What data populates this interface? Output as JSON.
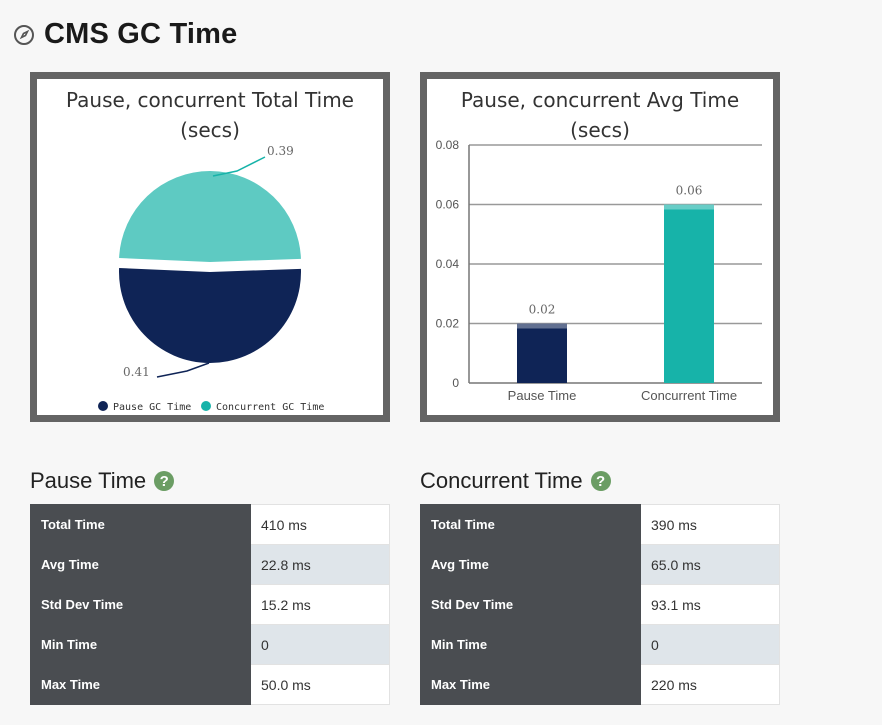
{
  "page": {
    "title": "CMS GC Time"
  },
  "colors": {
    "pause": "#0f2456",
    "concurrent": "#5ecac2",
    "concurrent_bar": "#17b3a9",
    "frame": "#646464"
  },
  "charts": {
    "pie": {
      "title_line1": "Pause, concurrent Total Time",
      "title_line2": "(secs)"
    },
    "bar": {
      "title_line1": "Pause, concurrent Avg Time",
      "title_line2": "(secs)"
    }
  },
  "chart_data": [
    {
      "type": "pie",
      "title": "Pause, concurrent Total Time (secs)",
      "slices": [
        {
          "name": "Pause GC Time",
          "value": 0.41,
          "label": "0.41"
        },
        {
          "name": "Concurrent GC Time",
          "value": 0.39,
          "label": "0.39"
        }
      ],
      "legend": [
        "Pause GC Time",
        "Concurrent GC Time"
      ],
      "legend_position": "bottom"
    },
    {
      "type": "bar",
      "title": "Pause, concurrent Avg Time (secs)",
      "categories": [
        "Pause Time",
        "Concurrent Time"
      ],
      "values": [
        0.02,
        0.06
      ],
      "value_labels": [
        "0.02",
        "0.06"
      ],
      "ylim": [
        0,
        0.08
      ],
      "yticks": [
        "0",
        "0.02",
        "0.04",
        "0.06",
        "0.08"
      ],
      "grid": true
    }
  ],
  "pause": {
    "title": "Pause Time",
    "rows": [
      {
        "label": "Total Time",
        "value": "410 ms"
      },
      {
        "label": "Avg Time",
        "value": "22.8 ms"
      },
      {
        "label": "Std Dev Time",
        "value": "15.2 ms"
      },
      {
        "label": "Min Time",
        "value": "0"
      },
      {
        "label": "Max Time",
        "value": "50.0 ms"
      }
    ]
  },
  "concurrent": {
    "title": "Concurrent Time",
    "rows": [
      {
        "label": "Total Time",
        "value": "390 ms"
      },
      {
        "label": "Avg Time",
        "value": "65.0 ms"
      },
      {
        "label": "Std Dev Time",
        "value": "93.1 ms"
      },
      {
        "label": "Min Time",
        "value": "0"
      },
      {
        "label": "Max Time",
        "value": "220 ms"
      }
    ]
  },
  "help_icon": {
    "glyph": "?",
    "icon": "question-circle-icon"
  }
}
